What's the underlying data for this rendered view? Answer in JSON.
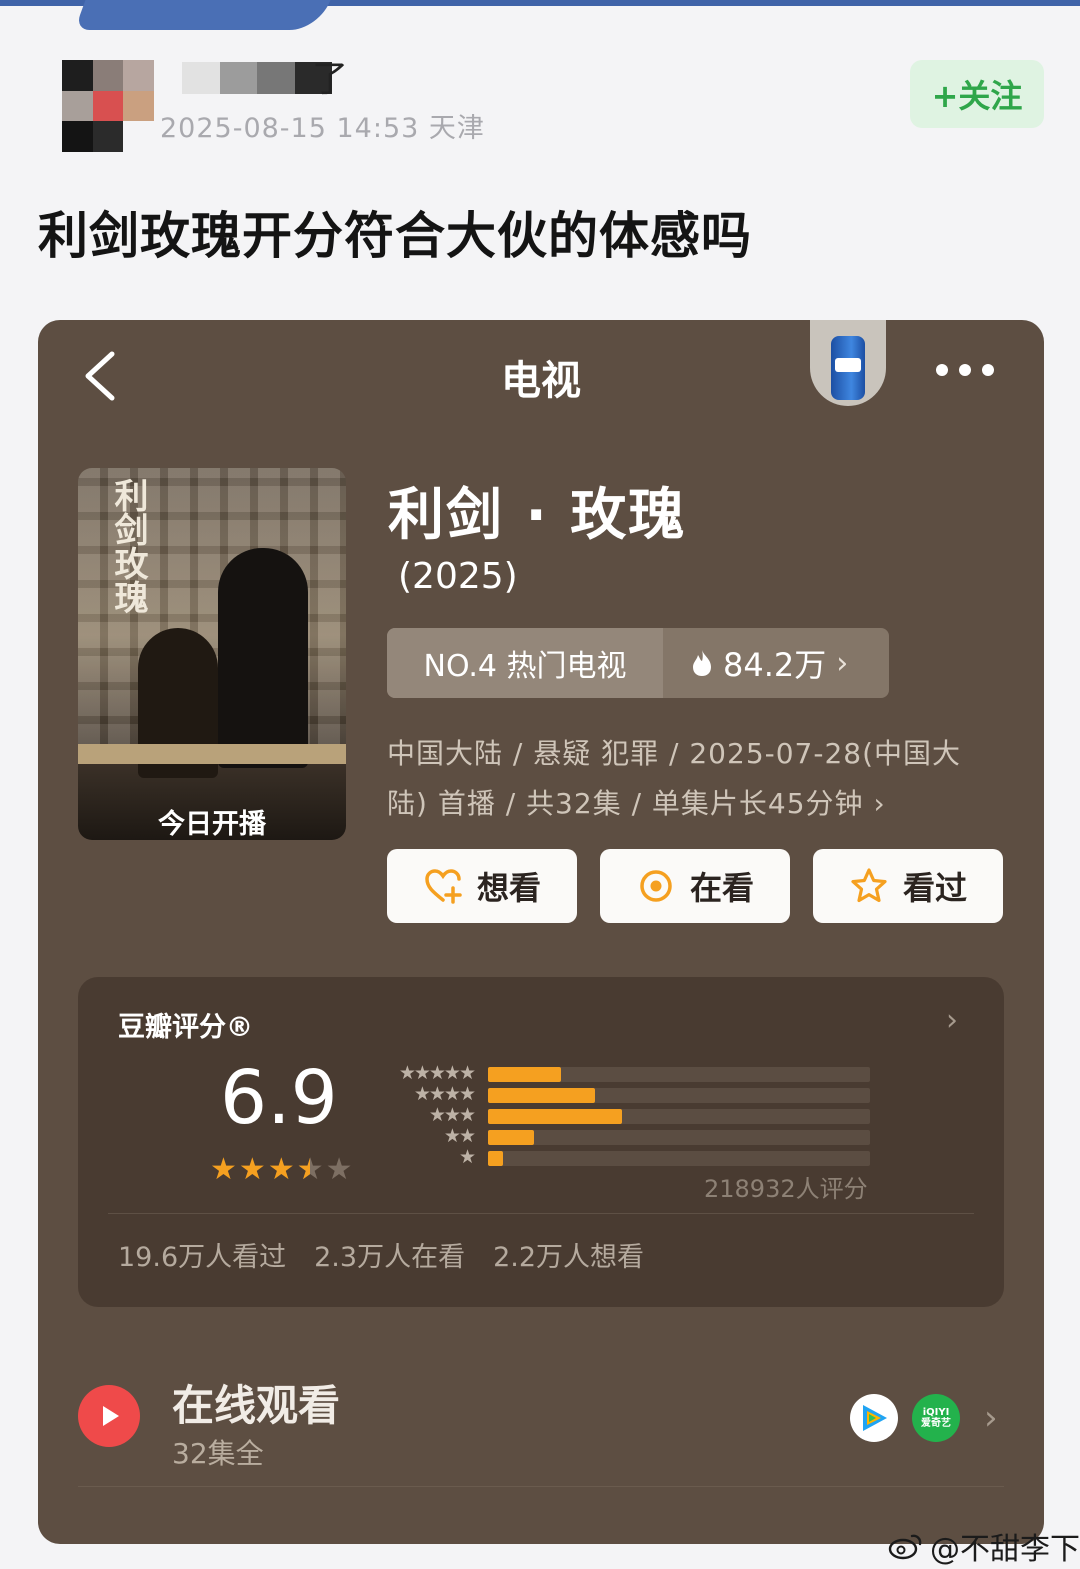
{
  "post": {
    "username_tail": "了",
    "meta": "2025-08-15 14:53 天津",
    "follow_label": "+关注",
    "title": "利剑玫瑰开分符合大伙的体感吗"
  },
  "screenshot": {
    "nav_title": "电视",
    "poster": {
      "title": "利剑玫瑰",
      "caption": "今日开播"
    },
    "show": {
      "title": "利剑 · 玫瑰",
      "year": "(2025)",
      "rank_label": "NO.4 热门电视",
      "heat": "84.2万",
      "info_line1": "中国大陆 / 悬疑 犯罪 / 2025-07-28(中国大",
      "info_line2": "陆) 首播 / 共32集 / 单集片长45分钟 ›"
    },
    "actions": [
      {
        "label": "想看",
        "icon": "heart-plus-icon"
      },
      {
        "label": "在看",
        "icon": "target-icon"
      },
      {
        "label": "看过",
        "icon": "star-outline-icon"
      }
    ],
    "rating": {
      "label": "豆瓣评分®",
      "score": "6.9",
      "stars": 3.5,
      "distribution": {
        "5_star": 0.19,
        "4_star": 0.28,
        "3_star": 0.35,
        "2_star": 0.12,
        "1_star": 0.04
      },
      "count_text": "218932人评分",
      "watched": "19.6万人看过",
      "watching": "2.3万人在看",
      "want": "2.2万人想看"
    },
    "online": {
      "title": "在线观看",
      "subtitle": "32集全",
      "platforms": [
        "tencent-video-icon",
        "iqiyi-icon"
      ],
      "iqiyi_text1": "iQIYI",
      "iqiyi_text2": "爱奇艺"
    }
  },
  "watermark": "@不甜李下",
  "colors": {
    "card_bg": "#5d4e42",
    "rating_bg": "#493b31",
    "accent_star": "#f5a020",
    "follow_green": "#2fa64a",
    "play_red": "#ef4a4a"
  }
}
